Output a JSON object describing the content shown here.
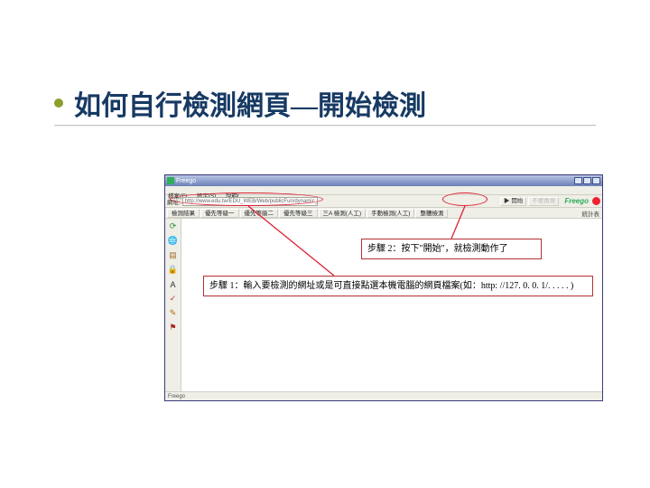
{
  "slide": {
    "title": "如何自行檢測網頁—開始檢測"
  },
  "window": {
    "title": "Freego",
    "menubar": [
      "檔案(F)",
      "設定(S)",
      "說明("
    ],
    "urlbar": {
      "label": "網址:",
      "value": "http://www.edu.tw/EDU_WEB/Web/publicFun/dynamic_default.php",
      "start_btn": "▶ 開始",
      "stop_btn": "不要再按",
      "logo": "Freego"
    },
    "tabs": [
      "檢測結果",
      "優先等級一",
      "優先等級二",
      "優先等級三",
      "三A 檢測(人工)",
      "手動檢測(人工)",
      "整體檢測"
    ],
    "tab_right": "統計表",
    "statusbar": "Freego"
  },
  "sidebar_icons": [
    {
      "name": "refresh-icon",
      "glyph": "⟳",
      "color": "#2d8a2d"
    },
    {
      "name": "globe-icon",
      "glyph": "🌐",
      "color": "#2a5fb0"
    },
    {
      "name": "page-icon",
      "glyph": "▤",
      "color": "#a07030"
    },
    {
      "name": "lock-icon",
      "glyph": "🔒",
      "color": "#888822"
    },
    {
      "name": "text-icon",
      "glyph": "A",
      "color": "#333333"
    },
    {
      "name": "check-icon",
      "glyph": "✓",
      "color": "#c03030"
    },
    {
      "name": "note-icon",
      "glyph": "✎",
      "color": "#b36a00"
    },
    {
      "name": "flag-icon",
      "glyph": "⚑",
      "color": "#aa2222"
    }
  ],
  "callouts": {
    "step2": "步驟 2：按下\"開始\"，就檢測動作了",
    "step1": "步驟 1：輸入要檢測的網址或是可直接點選本機電腦的網頁檔案(如：http: //127. 0. 0. 1/. . . . . )"
  }
}
